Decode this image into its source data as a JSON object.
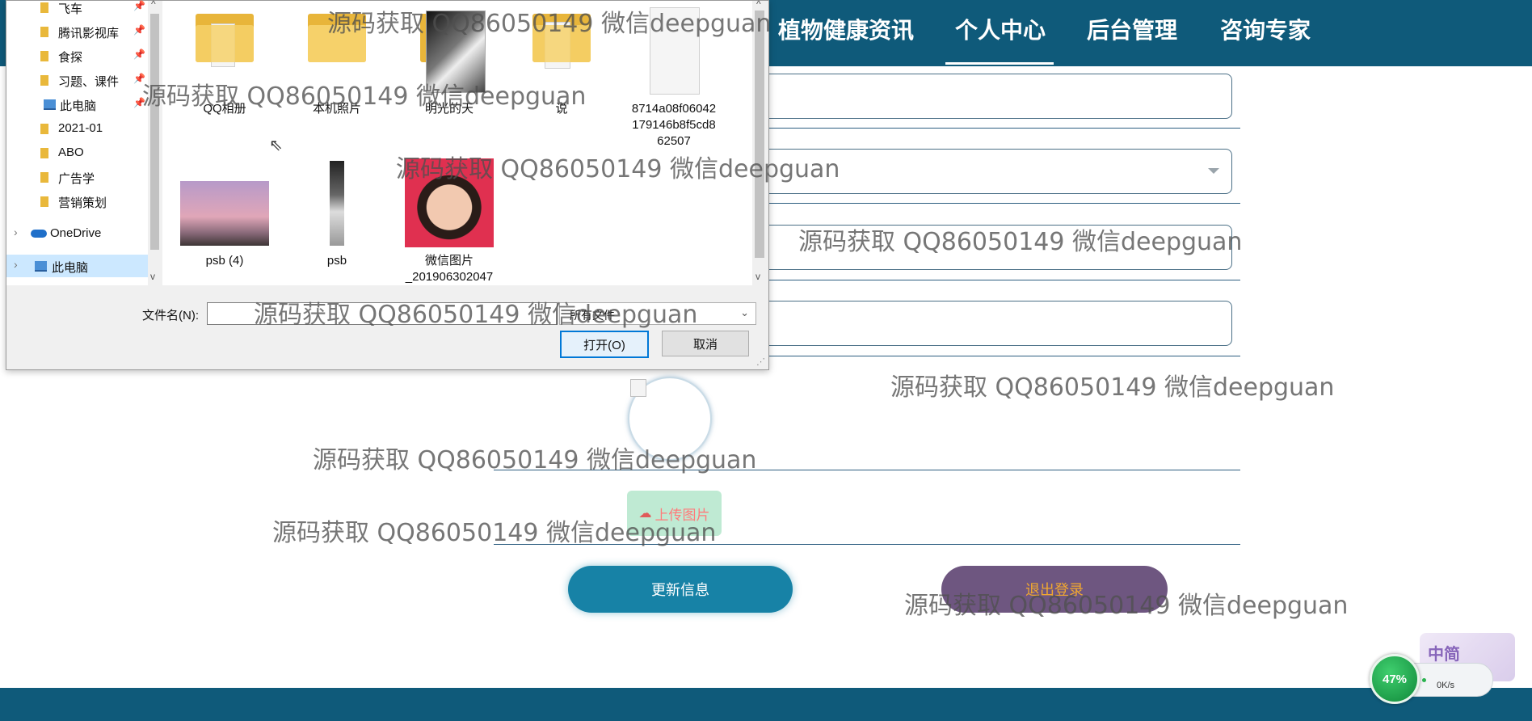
{
  "nav": {
    "items": [
      "植物健康资讯",
      "个人中心",
      "后台管理",
      "咨询专家"
    ],
    "active": "个人中心"
  },
  "profile": {
    "upload_label": "上传图片",
    "update_label": "更新信息",
    "logout_label": "退出登录"
  },
  "file_dialog": {
    "nav_items": [
      {
        "label": "飞车",
        "icon": "folder-icon",
        "pinned": true
      },
      {
        "label": "腾讯影视库",
        "icon": "folder-icon",
        "pinned": true
      },
      {
        "label": "食探",
        "icon": "folder-icon",
        "pinned": true
      },
      {
        "label": "习题、课件",
        "icon": "folder-icon",
        "pinned": true
      },
      {
        "label": "此电脑",
        "icon": "computer-icon",
        "pinned": true
      },
      {
        "label": "2021-01",
        "icon": "folder-icon",
        "pinned": false
      },
      {
        "label": "ABO",
        "icon": "folder-icon",
        "pinned": false
      },
      {
        "label": "广告学",
        "icon": "folder-icon",
        "pinned": false
      },
      {
        "label": "营销策划",
        "icon": "folder-icon",
        "pinned": false
      },
      {
        "label": "OneDrive",
        "icon": "cloud-icon",
        "pinned": false
      },
      {
        "label": "此电脑",
        "icon": "computer-icon",
        "pinned": false
      }
    ],
    "files": [
      {
        "name": "QQ相册",
        "kind": "folder"
      },
      {
        "name": "本机照片",
        "kind": "folder"
      },
      {
        "name": "明光的天",
        "kind": "folder"
      },
      {
        "name": "说",
        "kind": "folder"
      },
      {
        "name_lines": [
          "8714a08f06042",
          "179146b8f5cd8",
          "62507"
        ],
        "kind": "document"
      },
      {
        "name": "psb (4)",
        "kind": "image"
      },
      {
        "name": "psb",
        "kind": "image"
      },
      {
        "name_lines": [
          "微信图片",
          "_201906302047"
        ],
        "kind": "image"
      }
    ],
    "filename_label": "文件名(N):",
    "filename_value": "",
    "filetype_value": "所有文件",
    "open_label": "打开(O)",
    "cancel_label": "取消"
  },
  "speed_widget": {
    "percent": "47%",
    "rate": "0K/s"
  },
  "ime": {
    "label": "中简"
  },
  "watermark": "源码获取 QQ86050149 微信deepguan",
  "colors": {
    "nav_bg": "#0f5a7a",
    "update_btn": "#1782a6",
    "logout_btn": "#6e5680",
    "upload_btn": "#bfead3"
  }
}
